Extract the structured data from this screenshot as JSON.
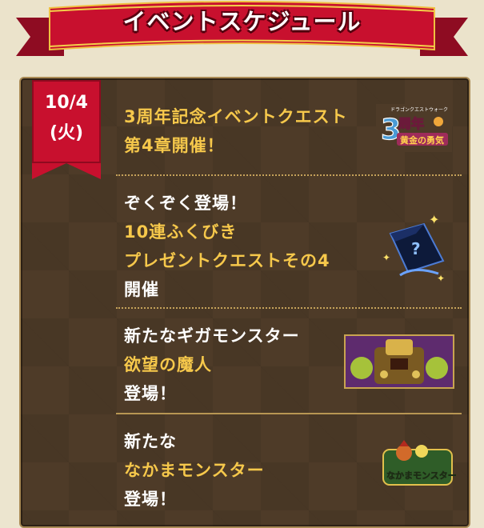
{
  "header": {
    "title": "イベントスケジュール"
  },
  "date": {
    "day": "10/4",
    "weekday": "(火)"
  },
  "events": [
    {
      "lines": [
        "3周年記念イベントクエスト",
        "第4章開催！"
      ],
      "thumb": "3周年 黄金の勇気",
      "thumb_tag": "ドラゴンクエストウォーク"
    },
    {
      "lines": [
        "ぞくぞく登場！",
        "10連ふくびき",
        "プレゼントクエストその4",
        "開催"
      ]
    },
    {
      "lines": [
        "新たなギガモンスター",
        "欲望の魔人",
        "登場！"
      ]
    },
    {
      "lines": [
        "新たな",
        "なかまモンスター",
        "登場！"
      ],
      "thumb": "なかまモンスター"
    }
  ],
  "colors": {
    "ribbon": "#c8102e",
    "panel": "#4e3b28",
    "gold_text": "#f6c84b",
    "badge": "#c8102e"
  },
  "icons": [
    "ribbon-banner",
    "anniversary-logo",
    "mystery-bag-icon",
    "giga-monster-thumbnail",
    "monster-badge-icon"
  ]
}
